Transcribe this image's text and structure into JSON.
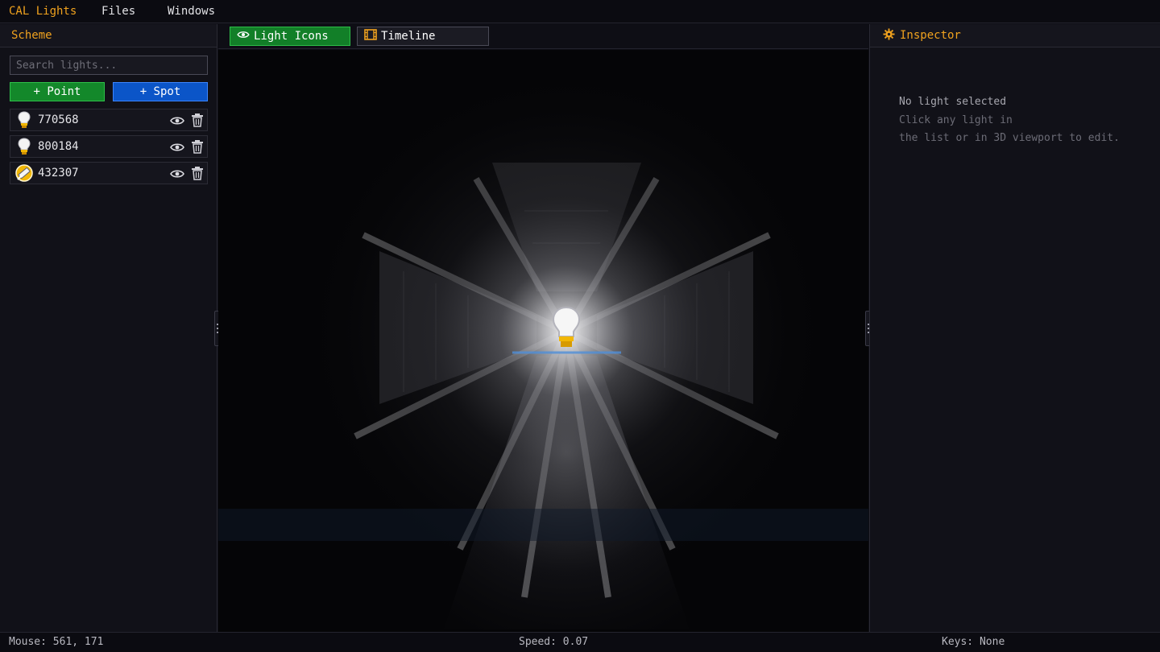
{
  "menubar": {
    "app_title": "CAL Lights",
    "items": [
      "Files",
      "Windows"
    ]
  },
  "scheme": {
    "title": "Scheme",
    "search_placeholder": "Search lights...",
    "add_point_label": "+ Point",
    "add_spot_label": "+ Spot",
    "lights": [
      {
        "name": "770568",
        "kind": "point",
        "icon": "bulb-icon"
      },
      {
        "name": "800184",
        "kind": "point",
        "icon": "bulb-icon"
      },
      {
        "name": "432307",
        "kind": "spot",
        "icon": "spotlight-icon"
      }
    ]
  },
  "tabs": {
    "light_icons_label": "Light Icons",
    "timeline_label": "Timeline"
  },
  "inspector": {
    "title": "Inspector",
    "empty_line1": "No light selected",
    "empty_line2": "Click any light in",
    "empty_line3": "the list or in 3D viewport to edit."
  },
  "status": {
    "mouse": "Mouse: 561, 171",
    "speed": "Speed: 0.07",
    "keys": "Keys: None"
  },
  "colors": {
    "accent": "#f0a21e",
    "point_button": "#13882a",
    "spot_button": "#0b55c8",
    "background": "#0d0d14"
  }
}
